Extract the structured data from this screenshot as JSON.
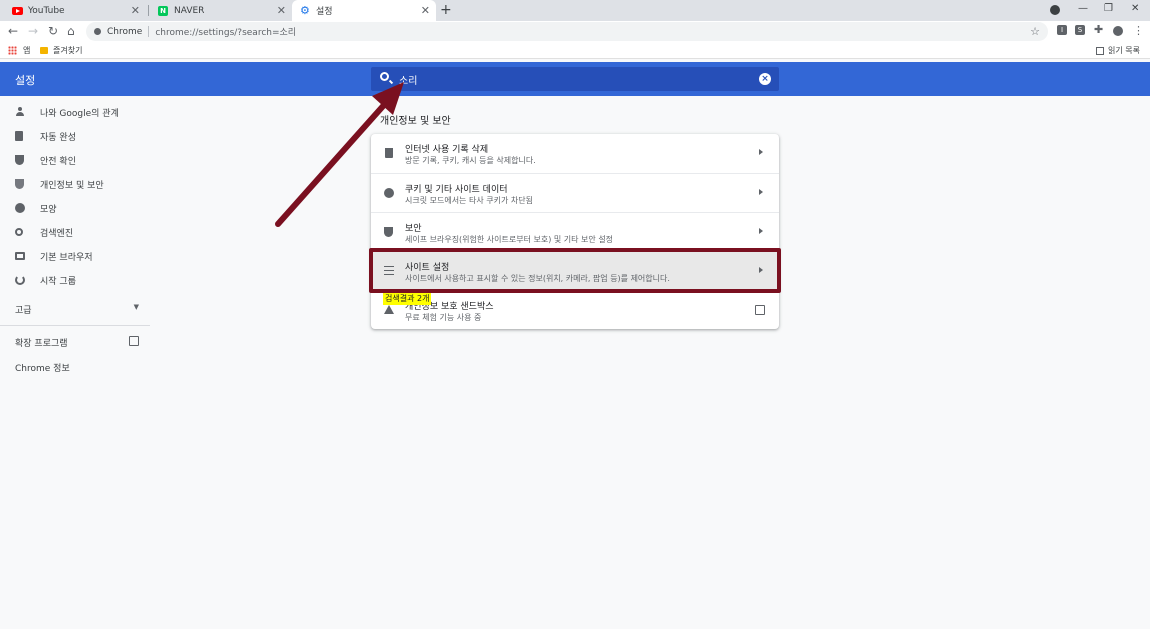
{
  "tabs": [
    {
      "title": "YouTube",
      "favicon": "youtube-icon"
    },
    {
      "title": "NAVER",
      "favicon": "naver-icon",
      "favicon_letter": "N"
    },
    {
      "title": "설정",
      "favicon": "gear-icon"
    }
  ],
  "toolbar": {
    "omnibox_label": "Chrome",
    "url": "chrome://settings/?search=소리",
    "extensions": [
      "I",
      "S"
    ]
  },
  "bookmarks": {
    "items": [
      {
        "label": "앱"
      },
      {
        "label": "즐겨찾기"
      }
    ],
    "reading_list": "읽기 목록"
  },
  "header": {
    "title": "설정",
    "search_value": "소리"
  },
  "sidebar": {
    "items": [
      {
        "label": "나와 Google의 관계",
        "icon": "person-icon"
      },
      {
        "label": "자동 완성",
        "icon": "clipboard-icon"
      },
      {
        "label": "안전 확인",
        "icon": "shield-check-icon"
      },
      {
        "label": "개인정보 및 보안",
        "icon": "shield-icon"
      },
      {
        "label": "모양",
        "icon": "palette-icon"
      },
      {
        "label": "검색엔진",
        "icon": "search-icon"
      },
      {
        "label": "기본 브라우저",
        "icon": "browser-icon"
      },
      {
        "label": "시작 그룹",
        "icon": "power-icon"
      }
    ],
    "advanced": "고급",
    "extensions": "확장 프로그램",
    "about": "Chrome 정보"
  },
  "section": {
    "title": "개인정보 및 보안",
    "rows": [
      {
        "title": "인터넷 사용 기록 삭제",
        "subtitle": "방문 기록, 쿠키, 캐시 등을 삭제합니다.",
        "icon": "trash-icon"
      },
      {
        "title": "쿠키 및 기타 사이트 데이터",
        "subtitle": "시크릿 모드에서는 타사 쿠키가 차단됨",
        "icon": "cookie-icon"
      },
      {
        "title": "보안",
        "subtitle": "세이프 브라우징(위험한 사이트로부터 보호) 및 기타 보안 설정",
        "icon": "shield-icon"
      },
      {
        "title": "사이트 설정",
        "subtitle": "사이트에서 사용하고 표시할 수 있는 정보(위치, 카메라, 팝업 등)를 제어합니다.",
        "icon": "tune-icon"
      },
      {
        "title": "개인정보 보호 샌드박스",
        "subtitle": "무료 체험 기능 사용 중",
        "icon": "warning-icon"
      }
    ],
    "search_badge": "검색결과 2개"
  },
  "colors": {
    "header_bg": "#3367d6",
    "search_bg": "#264fb8",
    "annotation": "#7a1020",
    "badge": "#ffff00"
  }
}
